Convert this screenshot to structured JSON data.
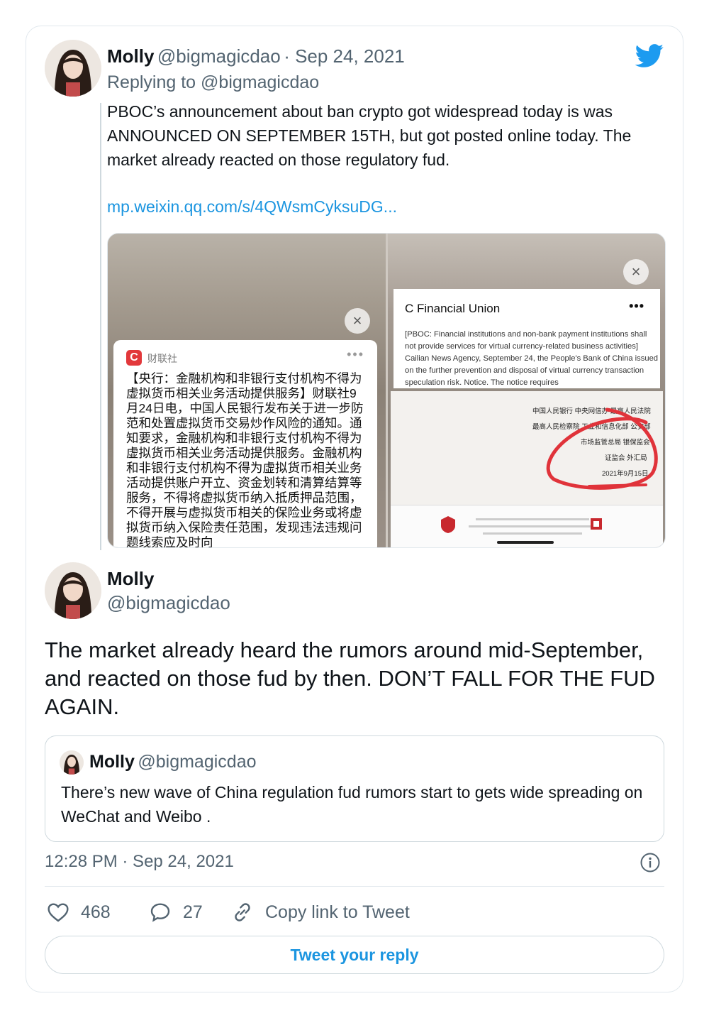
{
  "colors": {
    "accent": "#1b95e0",
    "text": "#0f1419",
    "muted": "#536471",
    "border": "#e1e8ed",
    "annotation_red": "#e0333a"
  },
  "first_tweet": {
    "name": "Molly",
    "handle": "@bigmagicdao",
    "date": "· Sep 24, 2021",
    "replying_to_prefix": "Replying to",
    "replying_to_handle": "@bigmagicdao",
    "text": "PBOC’s announcement about ban crypto got widespread today is was ANNOUNCED ON SEPTEMBER 15TH, but got posted online today. The market already reacted on those regulatory fud.",
    "link": "mp.weixin.qq.com/s/4QWsmCyksuDG...",
    "brand_icon": "twitter-bird-icon"
  },
  "media": {
    "left": {
      "source_logo": "C",
      "source_name": "财联社",
      "dots": "•••",
      "close": "×",
      "body": "【央行：金融机构和非银行支付机构不得为虚拟货币相关业务活动提供服务】财联社9月24日电，中国人民银行发布关于进一步防范和处置虚拟货币交易炒作风险的通知。通知要求，金融机构和非银行支付机构不得为虚拟货币相关业务活动提供服务。金融机构和非银行支付机构不得为虚拟货币相关业务活动提供账户开立、资金划转和清算结算等服务，不得将虚拟货币纳入抵质押品范围，不得开展与虚拟货币相关的保险业务或将虚拟货币纳入保险责任范围，发现违法违规问题线索应及时向"
    },
    "right": {
      "close": "×",
      "title": "C Financial Union",
      "dots": "•••",
      "body": "[PBOC: Financial institutions and non-bank payment institutions shall not provide services for virtual currency-related business activities] Cailian News Agency, September 24, the People's Bank of China issued on the further prevention and disposal of virtual currency transaction speculation risk. Notice. The notice requires",
      "doc_lines": [
        "中国人民银行 中央网信办 最高人民法院",
        "最高人民检察院 工业和信息化部 公安部",
        "市场监管总局 银保监会",
        "证监会 外汇局",
        "2021年9月15日"
      ]
    }
  },
  "main_tweet": {
    "name": "Molly",
    "handle": "@bigmagicdao",
    "text": "The market already heard the rumors around mid-September, and reacted on those fud by then. DON’T FALL FOR THE FUD AGAIN.",
    "timestamp": "12:28 PM · Sep 24, 2021"
  },
  "quoted_tweet": {
    "name": "Molly",
    "handle": "@bigmagicdao",
    "text": "There’s new wave of China regulation fud  rumors start to gets wide spreading on WeChat and Weibo ."
  },
  "actions": {
    "likes": "468",
    "replies": "27",
    "copy_link": "Copy link to Tweet",
    "reply_button": "Tweet your reply"
  }
}
